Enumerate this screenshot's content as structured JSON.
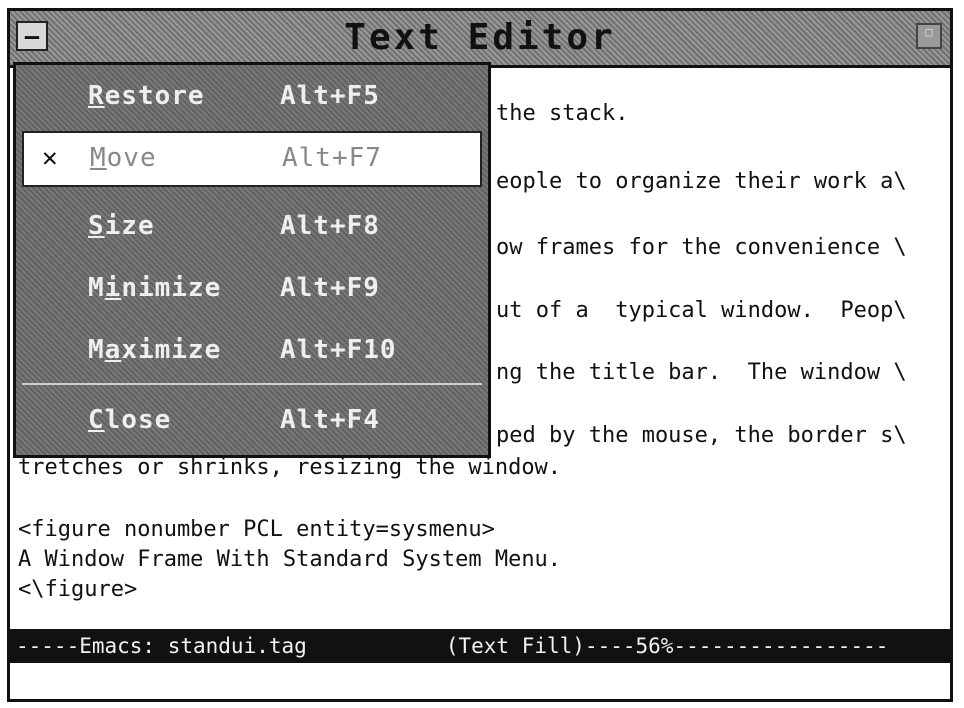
{
  "window": {
    "title": "Text Editor",
    "sysmenu_glyph": "—",
    "maximize_glyph": "□"
  },
  "menu": {
    "items": [
      {
        "label_u": "R",
        "label_rest": "estore",
        "accelerator": "Alt+F5",
        "checked": ""
      },
      {
        "label_u": "M",
        "label_rest": "ove",
        "accelerator": "Alt+F7",
        "checked": "✕"
      },
      {
        "label_u": "S",
        "label_rest": "ize",
        "accelerator": "Alt+F8",
        "checked": ""
      },
      {
        "label_pre": "M",
        "label_u": "i",
        "label_rest": "nimize",
        "accelerator": "Alt+F9",
        "checked": ""
      },
      {
        "label_pre": "M",
        "label_u": "a",
        "label_rest": "ximize",
        "accelerator": "Alt+F10",
        "checked": ""
      },
      {
        "label_u": "C",
        "label_rest": "lose",
        "accelerator": "Alt+F4",
        "checked": ""
      }
    ]
  },
  "buffer": {
    "lines": [
      "the stack.",
      "eople to organize their work a\\",
      "ow frames for the convenience \\",
      "ut of a  typical window.  Peop\\",
      "ng the title bar.  The window \\",
      "ped by the mouse, the border s\\",
      "tretches or shrinks, resizing the window.",
      "",
      "<figure nonumber PCL entity=sysmenu>",
      "A Window Frame With Standard System Menu.",
      "<\\figure>"
    ]
  },
  "modeline": {
    "text": "-----Emacs: standui.tag           (Text Fill)----56%-----------------"
  }
}
